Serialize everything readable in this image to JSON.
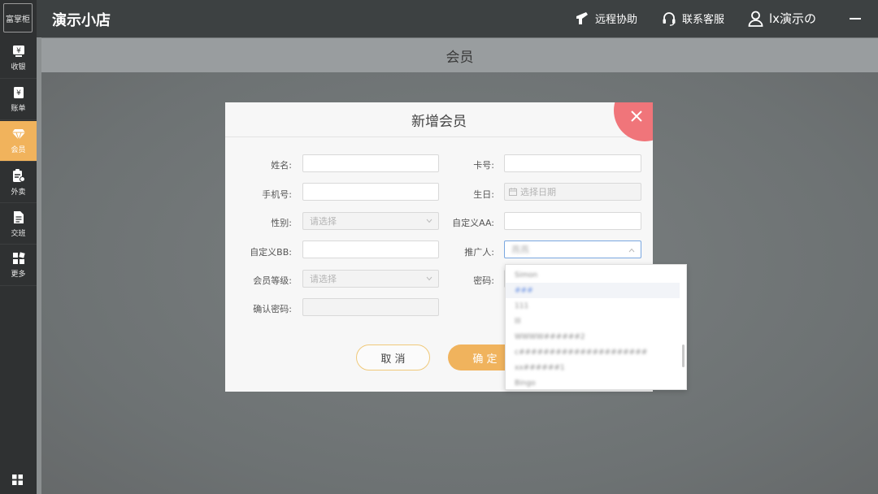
{
  "app": {
    "logo_text": "富掌柜",
    "store_name": "演示小店"
  },
  "sidebar": {
    "items": [
      {
        "label": "收银",
        "icon": "cashier-icon"
      },
      {
        "label": "账单",
        "icon": "bill-icon"
      },
      {
        "label": "会员",
        "icon": "diamond-icon",
        "active": true
      },
      {
        "label": "外卖",
        "icon": "takeout-icon"
      },
      {
        "label": "交班",
        "icon": "handover-icon"
      },
      {
        "label": "更多",
        "icon": "more-icon"
      }
    ]
  },
  "topbar": {
    "remote_help": "远程协助",
    "contact_service": "联系客服",
    "user": "lx演示の"
  },
  "page": {
    "title": "会员"
  },
  "modal": {
    "title": "新增会员",
    "fields": {
      "name": {
        "label": "姓名:",
        "value": ""
      },
      "card_no": {
        "label": "卡号:",
        "value": ""
      },
      "phone": {
        "label": "手机号:",
        "value": ""
      },
      "birthday": {
        "label": "生日:",
        "placeholder": "选择日期"
      },
      "gender": {
        "label": "性别:",
        "placeholder": "请选择"
      },
      "custom_aa": {
        "label": "自定义AA:",
        "value": ""
      },
      "custom_bb": {
        "label": "自定义BB:",
        "value": ""
      },
      "referrer": {
        "label": "推广人:",
        "value": "燕燕"
      },
      "level": {
        "label": "会员等级:",
        "placeholder": "请选择"
      },
      "password": {
        "label": "密码:",
        "value": ""
      },
      "confirm_password": {
        "label": "确认密码:",
        "value": ""
      }
    },
    "cancel_label": "取 消",
    "ok_label": "确 定"
  },
  "dropdown": {
    "options": [
      "Simon",
      "###",
      "111",
      "lll",
      "WWWW######2",
      "c#####################",
      "xx######1",
      "Bingo"
    ]
  },
  "colors": {
    "accent": "#f0b35d",
    "close": "#f0757a",
    "sidebar_bg": "#2f3132",
    "topbar_bg": "#3d4142"
  }
}
